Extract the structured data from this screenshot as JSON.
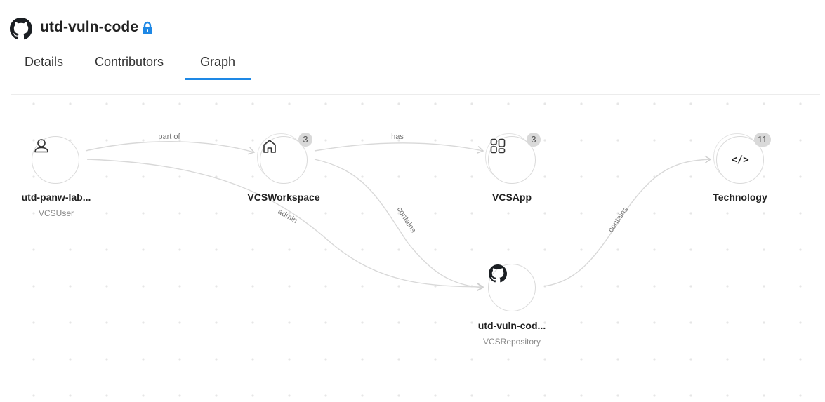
{
  "header": {
    "title": "utd-vuln-code",
    "repo_icon": "github-icon",
    "lock_icon": "lock-icon",
    "lock_color": "#1e88e5"
  },
  "tabs": [
    {
      "label": "Details",
      "active": false
    },
    {
      "label": "Contributors",
      "active": false
    },
    {
      "label": "Graph",
      "active": true
    }
  ],
  "accent_color": "#1e88e5",
  "graph": {
    "nodes": [
      {
        "id": "user",
        "label": "utd-panw-lab...",
        "type": "VCSUser",
        "icon": "user-icon"
      },
      {
        "id": "workspace",
        "label": "VCSWorkspace",
        "type": "",
        "icon": "home-icon",
        "count": "3"
      },
      {
        "id": "app",
        "label": "VCSApp",
        "type": "",
        "icon": "apps-grid-icon",
        "count": "3"
      },
      {
        "id": "technology",
        "label": "Technology",
        "type": "",
        "icon": "code-icon",
        "glyph": "</>",
        "count": "11"
      },
      {
        "id": "repo",
        "label": "utd-vuln-cod...",
        "type": "VCSRepository",
        "icon": "github-icon"
      }
    ],
    "edges": [
      {
        "from": "user",
        "to": "workspace",
        "label": "part of"
      },
      {
        "from": "user",
        "to": "repo",
        "label": "admin"
      },
      {
        "from": "workspace",
        "to": "app",
        "label": "has"
      },
      {
        "from": "workspace",
        "to": "repo",
        "label": "contains"
      },
      {
        "from": "repo",
        "to": "technology",
        "label": "contains"
      }
    ]
  }
}
